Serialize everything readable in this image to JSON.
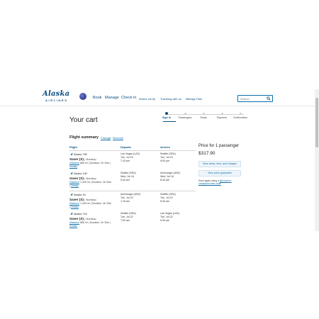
{
  "header": {
    "logo_word": "Alaska",
    "logo_sub": "AIRLINES",
    "nav": [
      "Book",
      "Manage",
      "Check in",
      "Where we fly",
      "Traveling with us",
      "Mileage Plan"
    ],
    "search_placeholder": "Search"
  },
  "page": {
    "title": "Your cart"
  },
  "steps": [
    "Sign in",
    "Passengers",
    "Seats",
    "Payment",
    "Confirmation"
  ],
  "summary": {
    "title": "Flight summary",
    "change_link": "Change",
    "separator": "/",
    "remove_link": "Remove",
    "col_flight": "Flight",
    "col_departs": "Departs",
    "col_arrives": "Arrives"
  },
  "segments": [
    {
      "flight": "Alaska 789",
      "fare": "Saver (X)",
      "stops": "Nonstop",
      "distance_label": "Distance",
      "distance": "866 mi",
      "duration": "Duration: 2h 34m",
      "details": "Details",
      "depart_city": "Las Vegas (LAS)",
      "depart_date": "Tue, Jul 15",
      "depart_time": "7:15 pm",
      "arrive_city": "Seattle (SEA)",
      "arrive_date": "Tue, Jul 15",
      "arrive_time": "9:53 pm"
    },
    {
      "flight": "Alaska 130",
      "fare": "Saver (X)",
      "stops": "Nonstop",
      "distance_label": "Distance",
      "distance": "1,449 mi",
      "duration": "Duration: 3h 54m",
      "details": "Details",
      "depart_city": "Seattle (SEA)",
      "depart_date": "Wed, Jul 16",
      "depart_time": "5:40 am",
      "arrive_city": "Anchorage (ANC)",
      "arrive_date": "Wed, Jul 16",
      "arrive_time": "8:34 am"
    },
    {
      "flight": "Alaska 94",
      "fare": "Saver (X)",
      "stops": "Nonstop",
      "distance_label": "Distance",
      "distance": "1,449 mi",
      "duration": "Duration: 3h 25m",
      "details": "Details",
      "depart_city": "Anchorage (ANC)",
      "depart_date": "Tue, Jul 22",
      "depart_time": "1:15 am",
      "arrive_city": "Seattle (SEA)",
      "arrive_date": "Tue, Jul 22",
      "arrive_time": "5:40 am"
    },
    {
      "flight": "Alaska 704",
      "fare": "Saver (X)",
      "stops": "Nonstop",
      "distance_label": "Distance",
      "distance": "866 mi",
      "duration": "Duration: 2h 30m",
      "details": "Details",
      "depart_city": "Seattle (SEA)",
      "depart_date": "Tue, Jul 22",
      "depart_time": "7:00 am",
      "arrive_city": "Las Vegas (LAS)",
      "arrive_date": "Tue, Jul 22",
      "arrive_time": "9:30 am"
    }
  ],
  "price": {
    "title": "Price for 1 passenger",
    "amount": "$317.90",
    "taxes_button": "View taxes, fees, and charges",
    "guarantee_button": "View price guarantee",
    "promo_text_1": "Save again using a",
    "promo_link": "discount or companion fare code"
  },
  "colors": {
    "brand_blue": "#0a4f7f",
    "link_blue": "#0a6ea8"
  }
}
